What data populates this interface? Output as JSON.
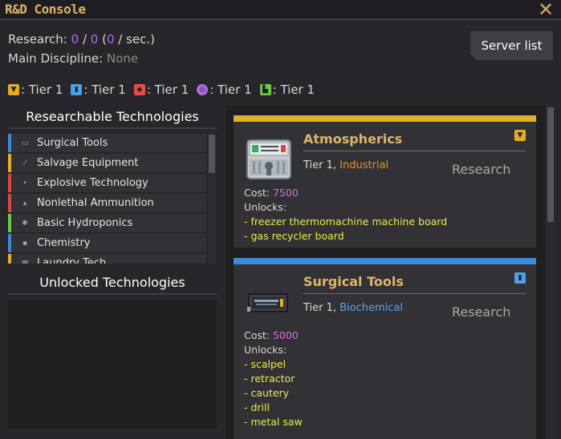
{
  "window": {
    "title": "R&D Console",
    "close_icon": "close-icon"
  },
  "research": {
    "label": "Research: ",
    "points": "0",
    "slash": " / ",
    "max": "0",
    "rate_open": " (",
    "rate": "0",
    "rate_unit": " / sec.)"
  },
  "discipline": {
    "label": "Main Discipline: ",
    "value": "None"
  },
  "server_button": "Server list",
  "tiers": [
    {
      "icon": "industrial-icon",
      "color": "#e3ad2a",
      "text": ": Tier 1"
    },
    {
      "icon": "biochemical-icon",
      "color": "#4aa0e8",
      "text": ": Tier 1"
    },
    {
      "icon": "security-icon",
      "color": "#e84b4b",
      "text": ": Tier 1"
    },
    {
      "icon": "bluespace-icon",
      "color": "#b06be8",
      "text": ": Tier 1"
    },
    {
      "icon": "engineering-icon",
      "color": "#6cc84a",
      "text": ": Tier 1"
    }
  ],
  "researchable_heading": "Researchable Technologies",
  "unlocked_heading": "Unlocked Technologies",
  "tech_list": [
    {
      "name": "Surgical Tools",
      "color": "#3c8bd6",
      "icon": "scalpel-icon"
    },
    {
      "name": "Salvage Equipment",
      "color": "#e3ad2a",
      "icon": "crowbar-icon"
    },
    {
      "name": "Explosive Technology",
      "color": "#d84646",
      "icon": "grenade-icon"
    },
    {
      "name": "Nonlethal Ammunition",
      "color": "#d84646",
      "icon": "ammo-icon"
    },
    {
      "name": "Basic Hydroponics",
      "color": "#6cc84a",
      "icon": "plant-icon"
    },
    {
      "name": "Chemistry",
      "color": "#3c8bd6",
      "icon": "beaker-icon"
    },
    {
      "name": "Laundry Tech",
      "color": "#e3ad2a",
      "icon": "laundry-icon"
    }
  ],
  "cards": [
    {
      "title": "Atmospherics",
      "band_color": "#e3ad2a",
      "badge_color": "#e3ad2a",
      "badge_icon": "industrial-icon",
      "tier": "Tier 1, ",
      "discipline": "Industrial",
      "research_label": "Research",
      "cost_label": "Cost: ",
      "cost": "7500",
      "unlocks_label": "Unlocks:",
      "unlocks": [
        "- freezer thermomachine machine board",
        "- gas recycler board"
      ]
    },
    {
      "title": "Surgical Tools",
      "band_color": "#3c8bd6",
      "badge_color": "#4aa0e8",
      "badge_icon": "biochemical-icon",
      "tier": "Tier 1, ",
      "discipline": "Biochemical",
      "research_label": "Research",
      "cost_label": "Cost: ",
      "cost": "5000",
      "unlocks_label": "Unlocks:",
      "unlocks": [
        "- scalpel",
        "- retractor",
        "- cautery",
        "- drill",
        "- metal saw"
      ]
    }
  ]
}
